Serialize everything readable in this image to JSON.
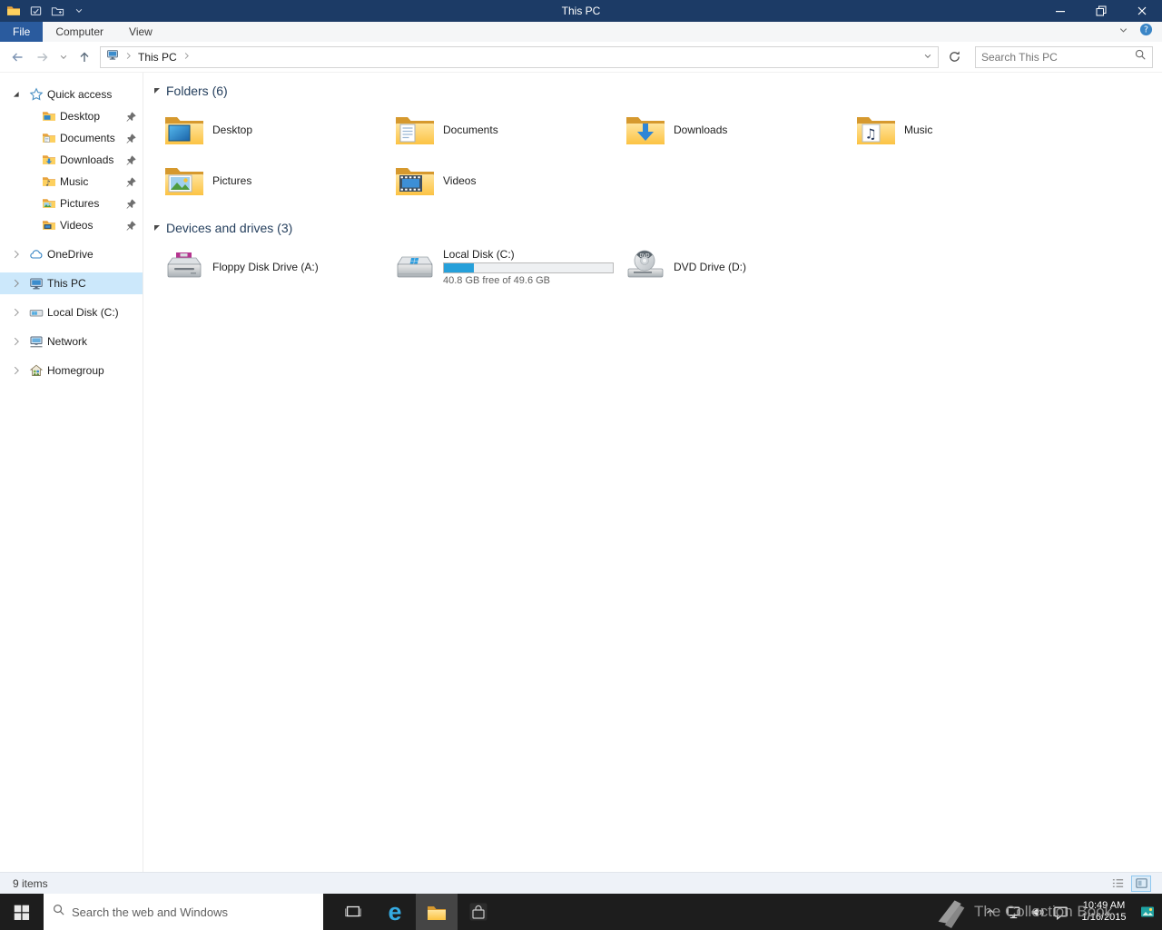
{
  "window": {
    "title": "This PC"
  },
  "menu": {
    "tabs": [
      {
        "label": "File"
      },
      {
        "label": "Computer"
      },
      {
        "label": "View"
      }
    ]
  },
  "navigation": {
    "breadcrumb": "This PC",
    "search_placeholder": "Search This PC"
  },
  "sidebar": {
    "items": [
      {
        "label": "Quick access"
      },
      {
        "label": "Desktop"
      },
      {
        "label": "Documents"
      },
      {
        "label": "Downloads"
      },
      {
        "label": "Music"
      },
      {
        "label": "Pictures"
      },
      {
        "label": "Videos"
      },
      {
        "label": "OneDrive"
      },
      {
        "label": "This PC"
      },
      {
        "label": "Local Disk (C:)"
      },
      {
        "label": "Network"
      },
      {
        "label": "Homegroup"
      }
    ]
  },
  "content": {
    "groups": [
      {
        "title": "Folders (6)",
        "items": [
          {
            "label": "Desktop"
          },
          {
            "label": "Documents"
          },
          {
            "label": "Downloads"
          },
          {
            "label": "Music"
          },
          {
            "label": "Pictures"
          },
          {
            "label": "Videos"
          }
        ]
      },
      {
        "title": "Devices and drives (3)",
        "items": [
          {
            "label": "Floppy Disk Drive (A:)"
          },
          {
            "label": "Local Disk (C:)",
            "capacity_text": "40.8 GB free of 49.6 GB",
            "used_percent": 18
          },
          {
            "label": "DVD Drive (D:)",
            "icon_text": "DVD"
          }
        ]
      }
    ]
  },
  "statusbar": {
    "items_count": "9 items"
  },
  "taskbar": {
    "search_placeholder": "Search the web and Windows",
    "clock": {
      "time": "10:49 AM",
      "date": "1/16/2015"
    },
    "watermark": "The Collection Book"
  },
  "colors": {
    "titlebar": "#1c3b66",
    "file_tab": "#2a5b9e",
    "sidebar_selection": "#cce8fb",
    "capacity_fill": "#26a0da",
    "taskbar": "#1d1d1d"
  },
  "icons": {
    "search": "magnifier",
    "pin": "pushpin",
    "refresh": "circular-arrow",
    "back": "arrow-left",
    "forward": "arrow-right",
    "up": "arrow-up"
  }
}
